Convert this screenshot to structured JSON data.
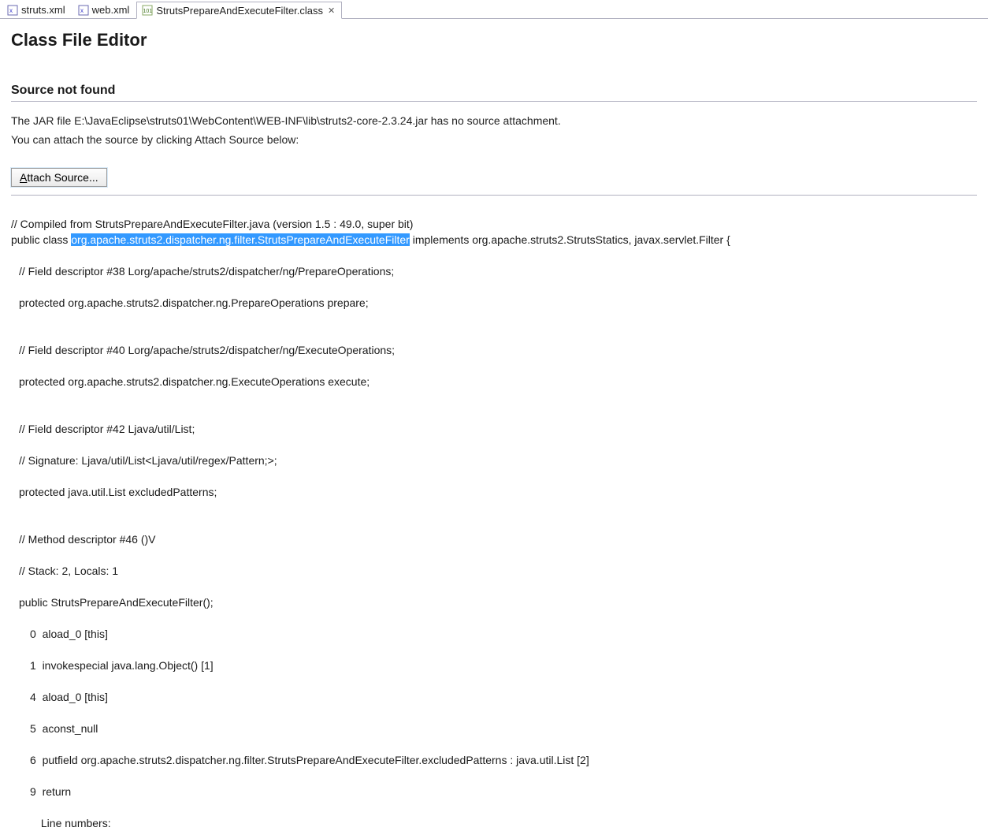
{
  "tabs": {
    "t0": {
      "label": "struts.xml"
    },
    "t1": {
      "label": "web.xml"
    },
    "t2": {
      "label": "StrutsPrepareAndExecuteFilter.class"
    }
  },
  "editor": {
    "title": "Class File Editor",
    "section": "Source not found",
    "line1": "The JAR file E:\\JavaEclipse\\struts01\\WebContent\\WEB-INF\\lib\\struts2-core-2.3.24.jar has no source attachment.",
    "line2": "You can attach the source by clicking Attach Source below:",
    "attach_key": "A",
    "attach_rest": "ttach Source..."
  },
  "code": {
    "c0": "// Compiled from StrutsPrepareAndExecuteFilter.java (version 1.5 : 49.0, super bit)",
    "c1a": "public class ",
    "c1hl": "org.apache.struts2.dispatcher.ng.filter.StrutsPrepareAndExecuteFilter",
    "c1b": " implements org.apache.struts2.StrutsStatics, javax.servlet.Filter {",
    "c2": "",
    "c3": "// Field descriptor #38 Lorg/apache/struts2/dispatcher/ng/PrepareOperations;",
    "c4": "protected org.apache.struts2.dispatcher.ng.PrepareOperations prepare;",
    "c5": "",
    "c6": "// Field descriptor #40 Lorg/apache/struts2/dispatcher/ng/ExecuteOperations;",
    "c7": "protected org.apache.struts2.dispatcher.ng.ExecuteOperations execute;",
    "c8": "",
    "c9": "// Field descriptor #42 Ljava/util/List;",
    "c10": "// Signature: Ljava/util/List<Ljava/util/regex/Pattern;>;",
    "c11": "protected java.util.List excludedPatterns;",
    "c12": "",
    "c13": "// Method descriptor #46 ()V",
    "c14": "// Stack: 2, Locals: 1",
    "c15": "public StrutsPrepareAndExecuteFilter();",
    "c16": "0  aload_0 [this]",
    "c17": "1  invokespecial java.lang.Object() [1]",
    "c18": "4  aload_0 [this]",
    "c19": "5  aconst_null",
    "c20": "6  putfield org.apache.struts2.dispatcher.ng.filter.StrutsPrepareAndExecuteFilter.excludedPatterns : java.util.List [2]",
    "c21": "9  return",
    "c22": " Line numbers:"
  }
}
